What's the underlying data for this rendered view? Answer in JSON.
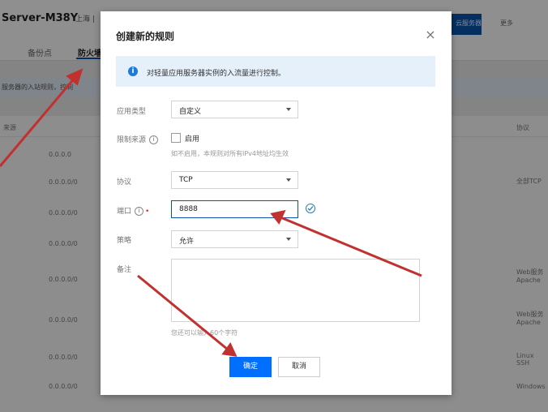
{
  "background": {
    "server_title": "Server-M38Y",
    "server_sub": "上海 |",
    "blue_button_label": "云服务器",
    "header_right": "更多",
    "tabs": [
      "备份点",
      "防火墙"
    ],
    "info_text": "服务器的入站规则，控制",
    "column_header": "来源",
    "column_header_right": "协议",
    "rows": [
      {
        "ip": "0.0.0.0",
        "extra": "全部TCP"
      },
      {
        "ip": "0.0.0.0/0",
        "extra": ""
      },
      {
        "ip": "0.0.0.0/0",
        "extra": ""
      },
      {
        "ip": "0.0.0.0/0",
        "extra": ""
      },
      {
        "ip": "0.0.0.0/0",
        "extra": "Web服务 Apache"
      },
      {
        "ip": "0.0.0.0/0",
        "extra": "Web服务 Apache"
      },
      {
        "ip": "0.0.0.0/0",
        "extra": "Linux SSH"
      },
      {
        "ip": "0.0.0.0/0",
        "extra": "Windows"
      }
    ]
  },
  "modal": {
    "title": "创建新的规则",
    "info": "对轻量应用服务器实例的入流量进行控制。",
    "fields": {
      "app_type": {
        "label": "应用类型",
        "value": "自定义"
      },
      "source": {
        "label": "限制来源",
        "checkbox_label": "启用",
        "hint": "如不启用，本规则对所有IPv4地址均生效"
      },
      "protocol": {
        "label": "协议",
        "value": "TCP"
      },
      "port": {
        "label": "端口",
        "value": "8888"
      },
      "policy": {
        "label": "策略",
        "value": "允许"
      },
      "remark": {
        "label": "备注",
        "counter": "您还可以输入60个字符"
      }
    },
    "ok_label": "确定",
    "cancel_label": "取消"
  },
  "colors": {
    "primary": "#006eff",
    "info_bg": "#e5f0fb",
    "annotation_arrow": "#c0312f"
  }
}
